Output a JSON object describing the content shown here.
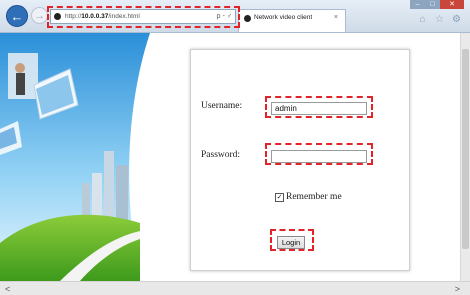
{
  "browser": {
    "address_url_prefix": "http://",
    "address_url_host": "10.0.0.37",
    "address_url_path": "/index.html",
    "address_tools": "ρ - ♂",
    "tab_title": "Network video client",
    "tab_close": "×",
    "win_minimize": "–",
    "win_maximize": "□",
    "win_close": "✕"
  },
  "login": {
    "username_label": "Username:",
    "username_value": "admin",
    "password_label": "Password:",
    "password_value": "",
    "remember_label": "Remember me",
    "remember_checked": true,
    "remember_mark": "✓",
    "login_button": "Login"
  },
  "highlight_color": "#e1232a"
}
